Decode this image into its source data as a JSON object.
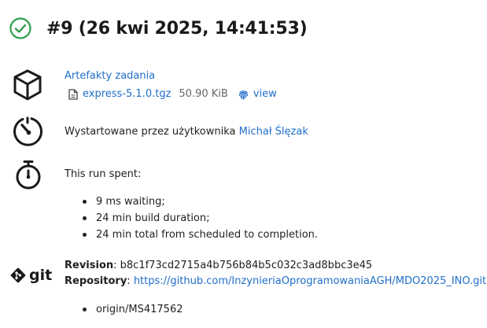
{
  "header": {
    "title": "#9 (26 kwi 2025, 14:41:53)",
    "status_color": "#2e9e4f"
  },
  "artifacts": {
    "heading": "Artefakty zadania",
    "file_name": "express-5.1.0.tgz",
    "file_size": "50.90 KiB",
    "view_label": "view"
  },
  "started": {
    "prefix": "Wystartowane przez użytkownika ",
    "user": "Michał Ślęzak"
  },
  "timing": {
    "heading": "This run spent:",
    "items": [
      "9 ms waiting;",
      "24 min build duration;",
      "24 min total from scheduled to completion."
    ]
  },
  "git": {
    "logo_text": "git",
    "revision_label": "Revision",
    "revision_value": "b8c1f73cd2715a4b756b84b5c032c3ad8bbc3e45",
    "repository_label": "Repository",
    "repository_url": "https://github.com/InzynieriaOprogramowaniaAGH/MDO2025_INO.git",
    "branches": [
      "origin/MS417562"
    ]
  },
  "colors": {
    "link": "#1f6fc9",
    "text": "#1f1f1f"
  }
}
